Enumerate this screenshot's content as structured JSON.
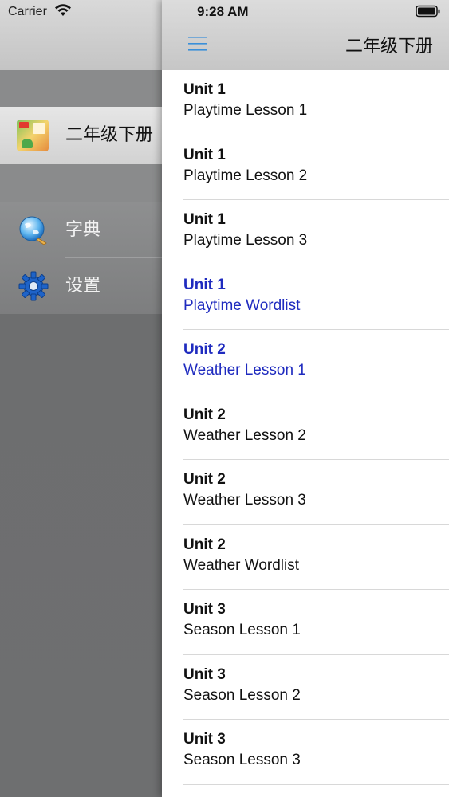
{
  "status": {
    "carrier": "Carrier",
    "time": "9:28 AM"
  },
  "drawer": {
    "book": {
      "label": "二年级下册"
    },
    "tools": [
      {
        "label": "字典",
        "icon": "globe-icon"
      },
      {
        "label": "设置",
        "icon": "gear-icon"
      }
    ]
  },
  "header": {
    "title": "二年级下册",
    "menu_icon": "hamburger-menu-icon"
  },
  "lessons": [
    {
      "unit": "Unit 1",
      "title": "Playtime Lesson 1",
      "highlighted": false
    },
    {
      "unit": "Unit 1",
      "title": "Playtime Lesson 2",
      "highlighted": false
    },
    {
      "unit": "Unit 1",
      "title": "Playtime Lesson 3",
      "highlighted": false
    },
    {
      "unit": "Unit 1",
      "title": "Playtime Wordlist",
      "highlighted": true
    },
    {
      "unit": "Unit 2",
      "title": "Weather Lesson 1",
      "highlighted": true
    },
    {
      "unit": "Unit 2",
      "title": "Weather Lesson 2",
      "highlighted": false
    },
    {
      "unit": "Unit 2",
      "title": "Weather Lesson 3",
      "highlighted": false
    },
    {
      "unit": "Unit 2",
      "title": "Weather Wordlist",
      "highlighted": false
    },
    {
      "unit": "Unit 3",
      "title": "Season Lesson 1",
      "highlighted": false
    },
    {
      "unit": "Unit 3",
      "title": "Season Lesson 2",
      "highlighted": false
    },
    {
      "unit": "Unit 3",
      "title": "Season Lesson 3",
      "highlighted": false
    }
  ],
  "colors": {
    "highlight_text": "#1f2bbf",
    "menu_icon": "#3a8fd9"
  }
}
